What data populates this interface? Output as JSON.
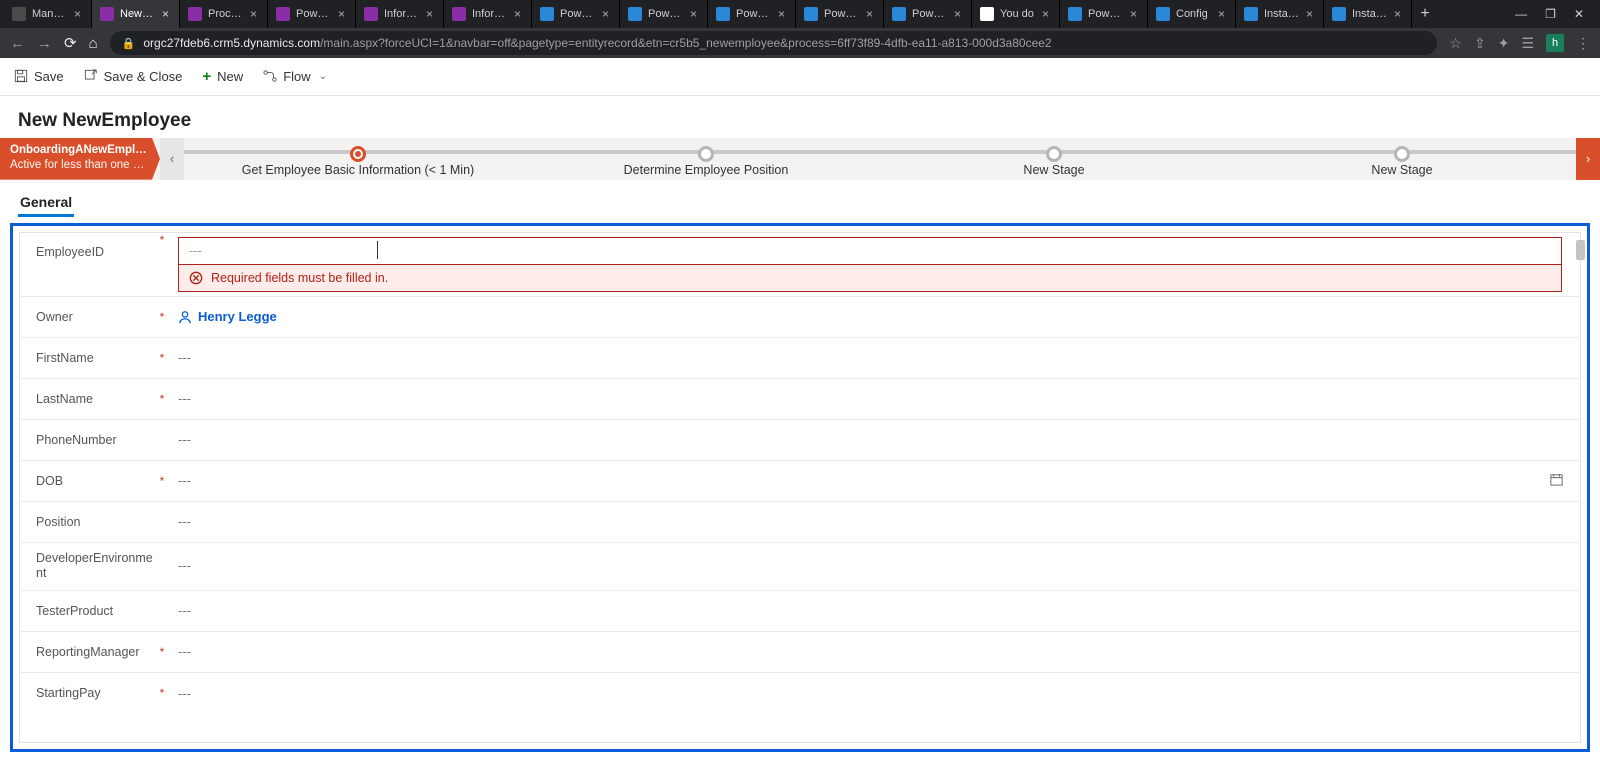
{
  "browser": {
    "tabs": [
      {
        "title": "Manage",
        "fav": "#4b4b4b"
      },
      {
        "title": "NewEm",
        "fav": "#8a2da5",
        "active": true
      },
      {
        "title": "Process",
        "fav": "#8a2da5"
      },
      {
        "title": "Power A",
        "fav": "#8a2da5"
      },
      {
        "title": "Informa",
        "fav": "#8a2da5"
      },
      {
        "title": "Informa",
        "fav": "#8a2da5"
      },
      {
        "title": "Power P",
        "fav": "#2b88d8"
      },
      {
        "title": "Power P",
        "fav": "#2b88d8"
      },
      {
        "title": "Power P",
        "fav": "#2b88d8"
      },
      {
        "title": "Power P",
        "fav": "#2b88d8"
      },
      {
        "title": "Power P",
        "fav": "#2b88d8"
      },
      {
        "title": "You do",
        "fav": "#ffffff"
      },
      {
        "title": "Power P",
        "fav": "#2b88d8"
      },
      {
        "title": "Config",
        "fav": "#2b88d8"
      },
      {
        "title": "Install a",
        "fav": "#2b88d8"
      },
      {
        "title": "Install a",
        "fav": "#2b88d8"
      }
    ],
    "url_host": "orgc27fdeb6.crm5.dynamics.com",
    "url_path": "/main.aspx?forceUCI=1&navbar=off&pagetype=entityrecord&etn=cr5b5_newemployee&process=6ff73f89-4dfb-ea11-a813-000d3a80cee2",
    "avatar": "h"
  },
  "commands": {
    "save": "Save",
    "save_close": "Save & Close",
    "new": "New",
    "flow": "Flow"
  },
  "page_title": "New NewEmployee",
  "bpf": {
    "process_name": "OnboardingANewEmplo...",
    "process_status": "Active for less than one mi...",
    "stages": [
      {
        "label": "Get Employee Basic Information  (< 1 Min)",
        "active": true
      },
      {
        "label": "Determine Employee Position"
      },
      {
        "label": "New Stage"
      },
      {
        "label": "New Stage"
      }
    ]
  },
  "tab_general": "General",
  "fields": {
    "employee_id": {
      "label": "EmployeeID",
      "req": "*",
      "value": "---"
    },
    "error_msg": "Required fields must be filled in.",
    "owner": {
      "label": "Owner",
      "req": "*",
      "value": "Henry Legge"
    },
    "first": {
      "label": "FirstName",
      "req": "*",
      "value": "---"
    },
    "last": {
      "label": "LastName",
      "req": "*",
      "value": "---"
    },
    "phone": {
      "label": "PhoneNumber",
      "value": "---"
    },
    "dob": {
      "label": "DOB",
      "req": "*",
      "value": "---"
    },
    "position": {
      "label": "Position",
      "value": "---"
    },
    "dev_env": {
      "label": "DeveloperEnvironment",
      "value": "---"
    },
    "tester": {
      "label": "TesterProduct",
      "value": "---"
    },
    "mgr": {
      "label": "ReportingManager",
      "req": "*",
      "value": "---"
    },
    "pay": {
      "label": "StartingPay",
      "req": "*",
      "value": "---"
    }
  }
}
